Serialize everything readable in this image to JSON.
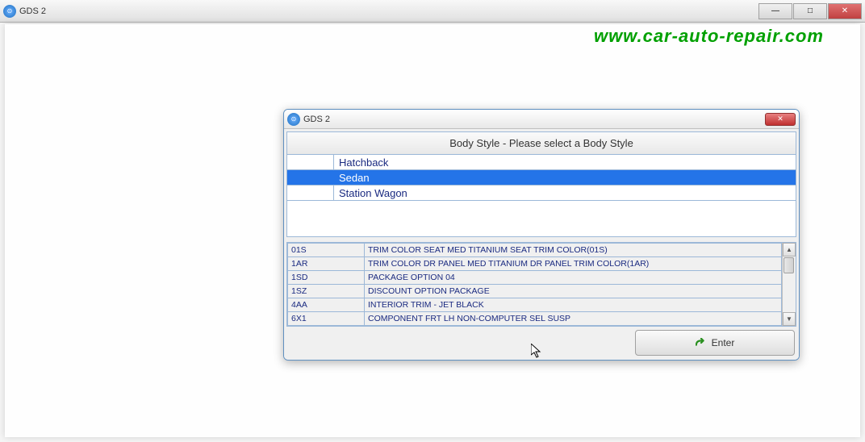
{
  "main_window": {
    "title": "GDS 2"
  },
  "watermark": "www.car-auto-repair.com",
  "dialog": {
    "title": "GDS 2",
    "prompt": "Body Style - Please select a Body Style",
    "body_styles": [
      {
        "label": "Hatchback",
        "selected": false
      },
      {
        "label": "Sedan",
        "selected": true
      },
      {
        "label": "Station Wagon",
        "selected": false
      }
    ],
    "options": [
      {
        "code": "01S",
        "description": "TRIM COLOR SEAT MED TITANIUM SEAT TRIM COLOR(01S)"
      },
      {
        "code": "1AR",
        "description": "TRIM COLOR DR PANEL MED TITANIUM DR PANEL TRIM COLOR(1AR)"
      },
      {
        "code": "1SD",
        "description": "PACKAGE OPTION 04"
      },
      {
        "code": "1SZ",
        "description": "DISCOUNT OPTION PACKAGE"
      },
      {
        "code": "4AA",
        "description": "INTERIOR TRIM - JET BLACK"
      },
      {
        "code": "6X1",
        "description": "COMPONENT FRT LH NON-COMPUTER SEL SUSP"
      }
    ],
    "enter_button": "Enter"
  }
}
